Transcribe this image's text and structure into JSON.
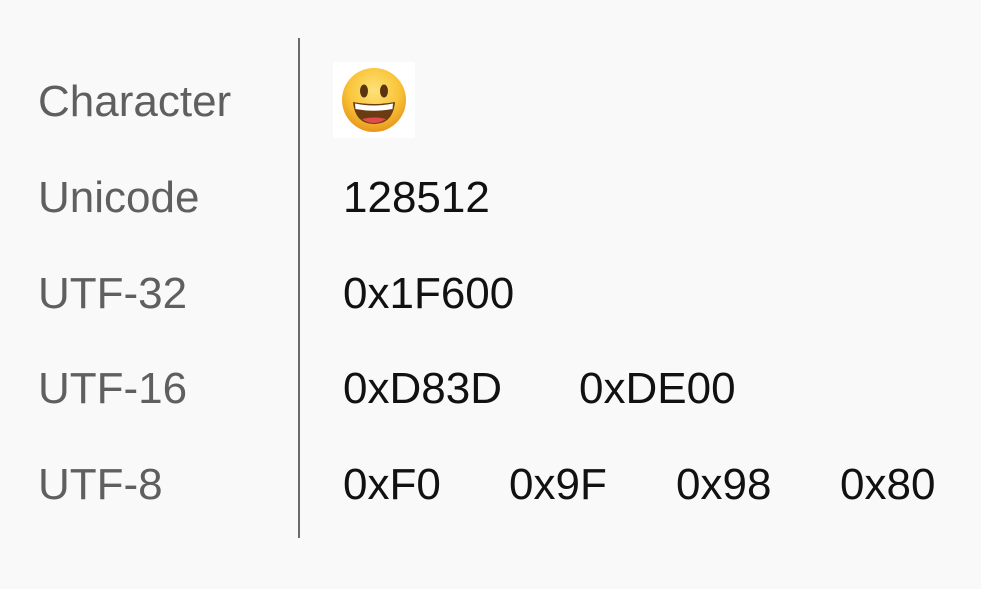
{
  "rows": {
    "character": {
      "label": "Character",
      "emoji_name": "grinning-face-emoji"
    },
    "unicode": {
      "label": "Unicode",
      "value": "128512"
    },
    "utf32": {
      "label": "UTF-32",
      "value": "0x1F600"
    },
    "utf16": {
      "label": "UTF-16",
      "values": [
        "0xD83D",
        "0xDE00"
      ]
    },
    "utf8": {
      "label": "UTF-8",
      "values": [
        "0xF0",
        "0x9F",
        "0x98",
        "0x80"
      ]
    }
  },
  "colors": {
    "background": "#f9f9f9",
    "label_text": "#5f5f5f",
    "value_text": "#111111",
    "divider": "#6b6b6b",
    "emoji_face": "#f7b62a"
  }
}
